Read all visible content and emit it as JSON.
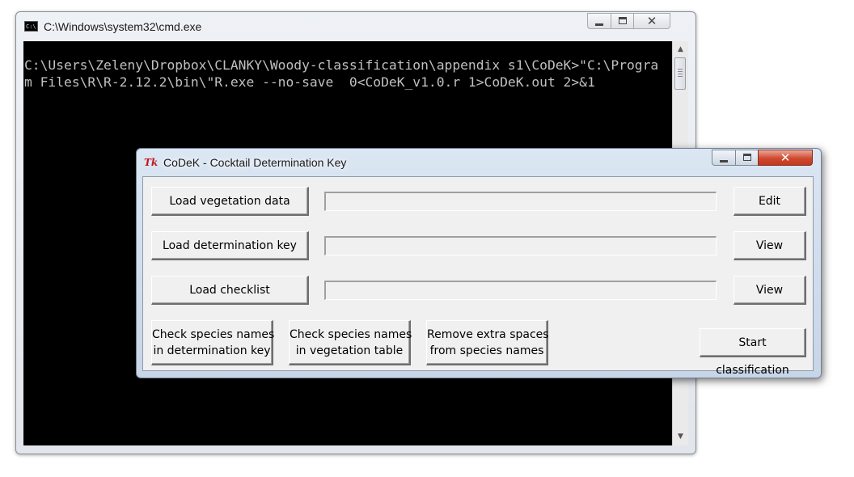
{
  "cmd_window": {
    "title": "C:\\Windows\\system32\\cmd.exe",
    "icon": "C:\\",
    "console_lines": [
      "C:\\Users\\Zeleny\\Dropbox\\CLANKY\\Woody-classification\\appendix s1\\CoDeK>\"C:\\Progra",
      "m Files\\R\\R-2.12.2\\bin\\\"R.exe --no-save  0<CoDeK_v1.0.r 1>CoDeK.out 2>&1"
    ]
  },
  "tk_window": {
    "title": "CoDeK - Cocktail Determination Key",
    "icon": "Tk",
    "accent_close": "#c0391e",
    "rows": [
      {
        "load_label": "Load vegetation data",
        "action_label": "Edit",
        "entry_value": ""
      },
      {
        "load_label": "Load determination key",
        "action_label": "View",
        "entry_value": ""
      },
      {
        "load_label": "Load checklist",
        "action_label": "View",
        "entry_value": ""
      }
    ],
    "bottom": {
      "check_key_label": "Check species names\nin determination key",
      "check_veg_label": "Check species names\nin vegetation table",
      "remove_spaces_label": "Remove extra spaces\nfrom species names",
      "start_label": "Start classification"
    }
  }
}
